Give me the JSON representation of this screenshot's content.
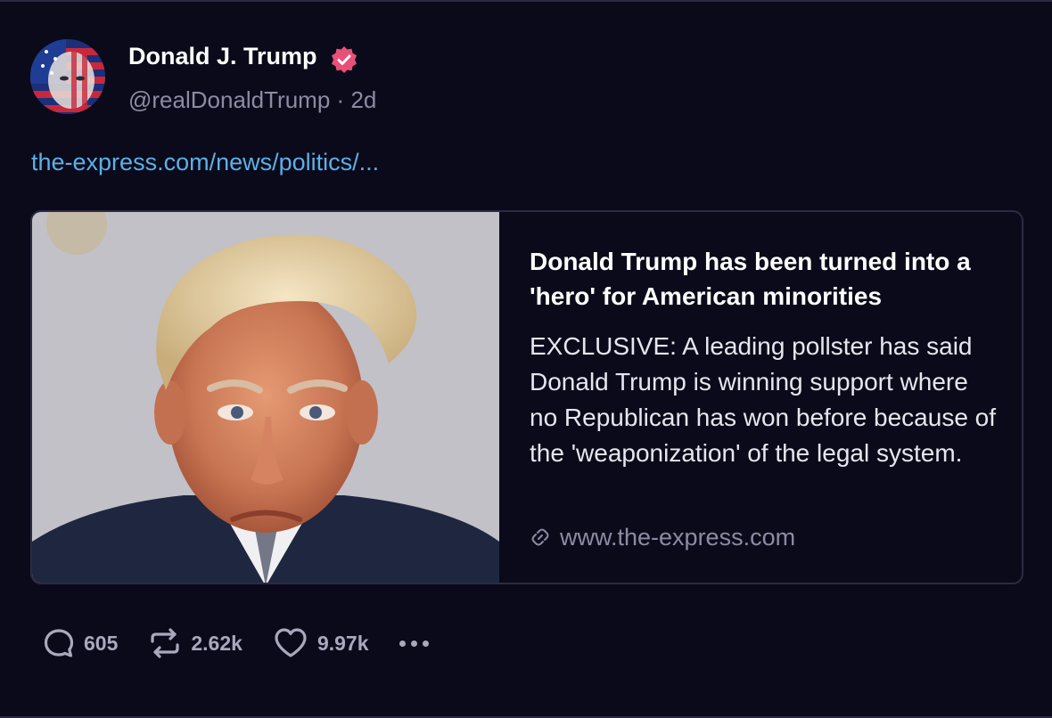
{
  "post": {
    "author": {
      "display_name": "Donald J. Trump",
      "handle": "@realDonaldTrump",
      "separator": "·",
      "time_ago": "2d",
      "verified": true,
      "verified_color": "#e8507a"
    },
    "link_text": "the-express.com/news/politics/...",
    "link_color": "#5bb0e8",
    "card": {
      "title": "Donald Trump has been turned into a 'hero' for American minorities",
      "description": "EXCLUSIVE: A leading pollster has said Donald Trump is winning support where no Republican has won before because of the 'weaponization' of the legal system.",
      "domain": "www.the-express.com",
      "domain_icon": "link-icon",
      "image": "mugshot-photo"
    },
    "actions": {
      "replies": "605",
      "reposts": "2.62k",
      "likes": "9.97k",
      "more_icon": "more-dots-icon"
    }
  },
  "colors": {
    "background": "#0b0a1a",
    "muted_text": "#8c8ba3",
    "border": "#2c2b42"
  }
}
